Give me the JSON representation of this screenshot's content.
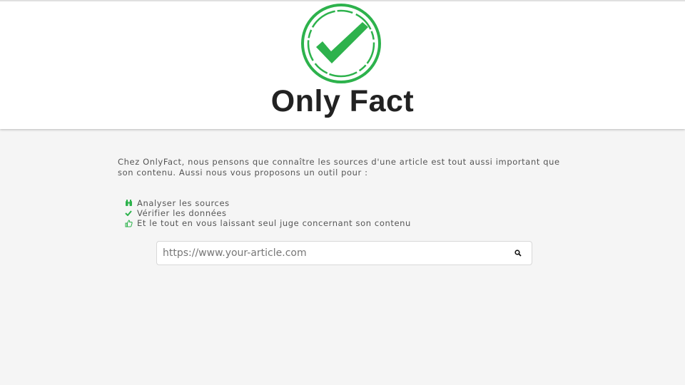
{
  "header": {
    "brand": "Only Fact",
    "accent_color": "#2db24c",
    "logo_icon": "check-stamp-icon"
  },
  "main": {
    "intro": "Chez OnlyFact, nous pensons que connaître les sources d'une article est tout aussi important que son contenu. Aussi nous vous proposons un outil pour :",
    "features": [
      {
        "icon": "binoculars-icon",
        "label": "Analyser les sources"
      },
      {
        "icon": "checkmark-icon",
        "label": "Vérifier les données"
      },
      {
        "icon": "thumbs-up-icon",
        "label": "Et le tout en vous laissant seul juge concernant son contenu"
      }
    ]
  },
  "search": {
    "placeholder": "https://www.your-article.com",
    "button_icon": "search-icon"
  }
}
